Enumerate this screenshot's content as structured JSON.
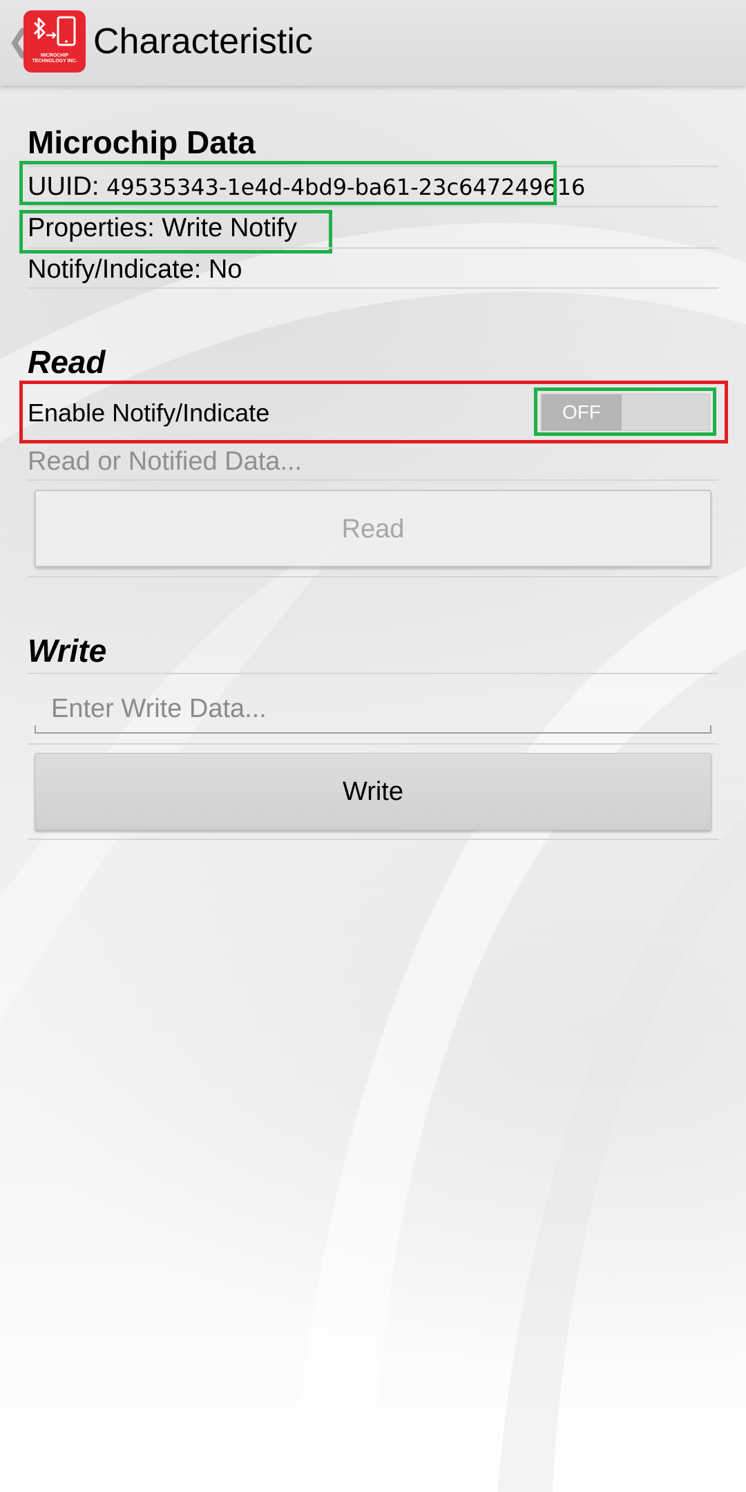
{
  "app_bar": {
    "title": "Characteristic",
    "logo_text": "MICROCHIP TECHNOLOGY INC.",
    "back_icon": "chevron-left-icon",
    "background_color": "#e0e0e0"
  },
  "characteristic_info": {
    "heading": "Microchip Data",
    "uuid_label": "UUID:",
    "uuid_value": "49535343-1e4d-4bd9-ba61-23c647249616",
    "properties": "Properties: Write Notify",
    "notify_indicate": "Notify/Indicate: No"
  },
  "read_section": {
    "heading": "Read",
    "enable_notify_label": "Enable Notify/Indicate",
    "toggle_state": "OFF",
    "data_placeholder": "Read or Notified Data...",
    "read_button": "Read"
  },
  "write_section": {
    "heading": "Write",
    "input_placeholder": "Enter Write Data...",
    "input_value": "",
    "write_button": "Write"
  },
  "colors": {
    "highlight_green": "#1fb04a",
    "highlight_red": "#e31d24",
    "logo_red": "#e8262f",
    "disabled_text": "#a6a6a6"
  }
}
